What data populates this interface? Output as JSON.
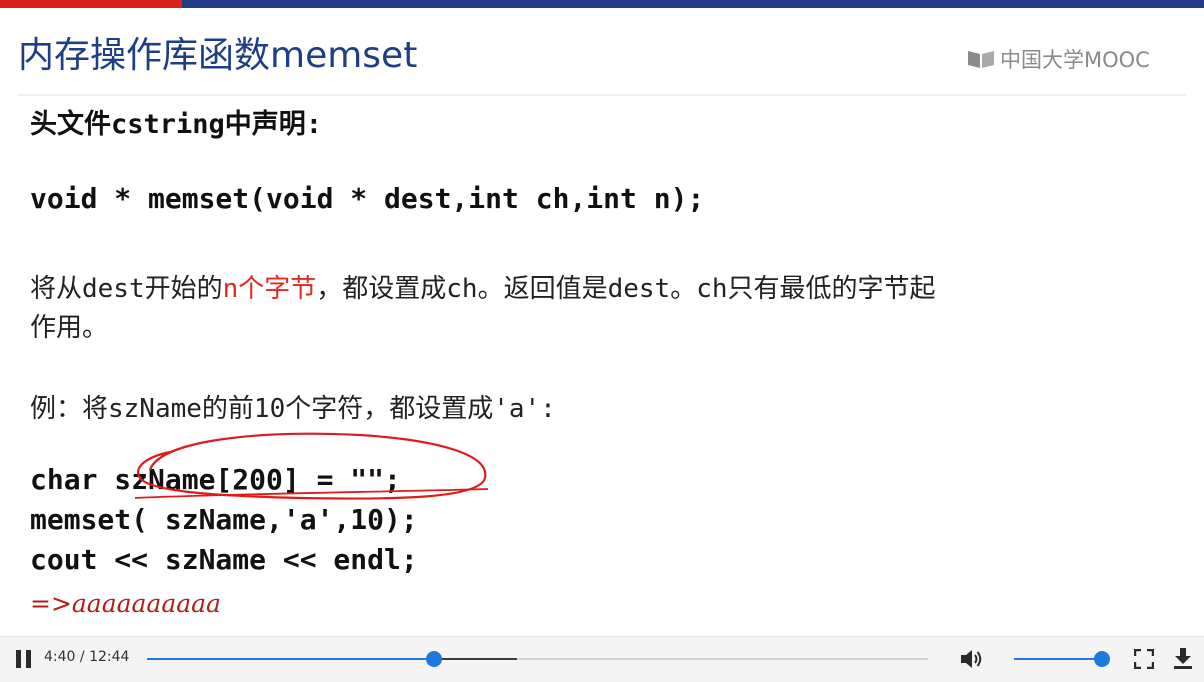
{
  "slide": {
    "title": "内存操作库函数memset",
    "logo_text": "中国大学MOOC",
    "header_line": "头文件cstring中声明:",
    "prototype": "void * memset(void * dest,int ch,int n);",
    "desc_before": "将从dest开始的",
    "desc_highlight": "n个字节",
    "desc_after": "，都设置成ch。返回值是dest。ch只有最低的字节起",
    "desc_line2": "作用。",
    "example_label": "例：将szName的前10个字符，都设置成'a':",
    "code_lines": [
      "char szName[200] = \"\";",
      "memset( szName,'a',10);",
      "cout << szName << endl;"
    ],
    "result": "=>aaaaaaaaaa"
  },
  "player": {
    "current_time": "4:40",
    "separator": "/",
    "duration": "12:44",
    "progress_fraction": 0.367,
    "buffered_fraction": 0.474,
    "volume_fraction": 1.0,
    "icons": {
      "play_pause": "pause-icon",
      "volume": "volume-icon",
      "fullscreen": "fullscreen-icon",
      "download": "download-icon"
    }
  },
  "colors": {
    "title_blue": "#1e3f86",
    "accent_red": "#d9201a",
    "highlight_red": "#e02a22",
    "progress_blue": "#1f7ae0"
  }
}
